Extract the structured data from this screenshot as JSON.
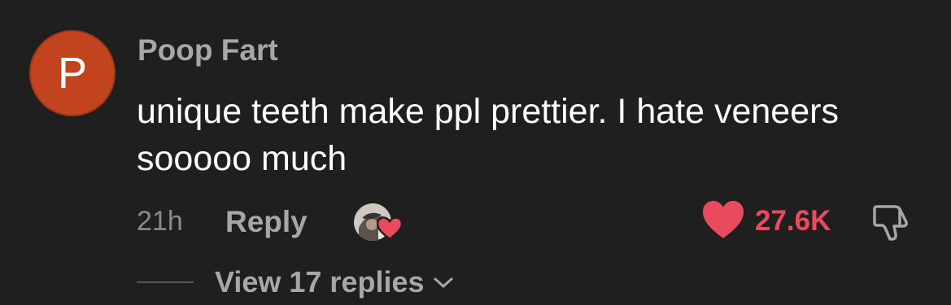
{
  "comment": {
    "avatar_letter": "P",
    "username": "Poop Fart",
    "text": "unique teeth make ppl prettier. I hate veneers sooooo much",
    "timestamp": "21h",
    "reply_label": "Reply",
    "like_count": "27.6K",
    "liked": true,
    "liked_by_creator": true,
    "view_replies_label": "View 17 replies"
  },
  "colors": {
    "background": "#1f1f1f",
    "avatar": "#c2441f",
    "like_accent": "#ea4a5e",
    "muted_text": "#a7a7a7",
    "timestamp_text": "#8a8a8a",
    "body_text": "#ffffff"
  },
  "icons": {
    "like": "heart-icon",
    "dislike": "thumbs-down-icon",
    "creator_like_badge": "heart-icon",
    "expand": "chevron-down-icon"
  }
}
